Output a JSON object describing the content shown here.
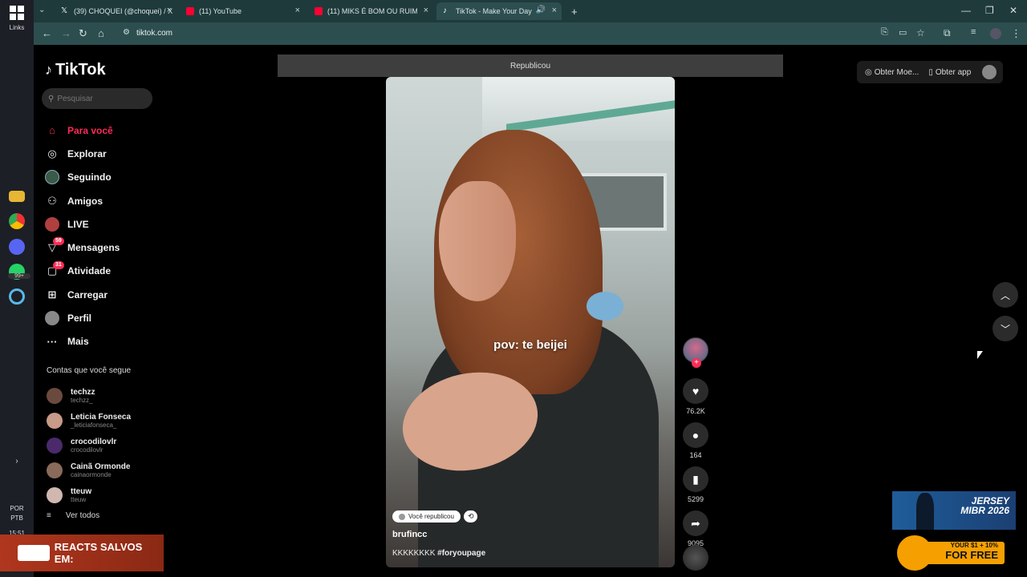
{
  "taskbar": {
    "links_label": "Links",
    "lang": "POR",
    "layout": "PTB",
    "time": "15:51",
    "date_fragment": "23",
    "whatsapp_badge": "99+"
  },
  "browser": {
    "tabs": [
      {
        "label": "(39) CHOQUEI (@choquei) / X",
        "icon": "x-icon",
        "color": "#222222"
      },
      {
        "label": "(11) YouTube",
        "icon": "youtube-icon",
        "color": "#ff0033"
      },
      {
        "label": "(11) MIKS É BOM OU RUIM? TE",
        "icon": "youtube-icon",
        "color": "#ff0033"
      },
      {
        "label": "TikTok - Make Your Day",
        "icon": "tiktok-icon",
        "color": "#111111"
      }
    ],
    "new_tab": "+",
    "url": "tiktok.com",
    "controls": {
      "minimize": "—",
      "restore": "❐",
      "close": "✕"
    }
  },
  "sidebar": {
    "logo_text": "TikTok",
    "search_placeholder": "Pesquisar",
    "nav": [
      {
        "label": "Para você",
        "icon": "home-icon",
        "active": true
      },
      {
        "label": "Explorar",
        "icon": "compass-icon"
      },
      {
        "label": "Seguindo",
        "icon": "following-icon"
      },
      {
        "label": "Amigos",
        "icon": "friends-icon"
      },
      {
        "label": "LIVE",
        "icon": "live-icon"
      },
      {
        "label": "Mensagens",
        "icon": "messages-icon",
        "badge": "59"
      },
      {
        "label": "Atividade",
        "icon": "activity-icon",
        "badge": "31"
      },
      {
        "label": "Carregar",
        "icon": "upload-icon"
      },
      {
        "label": "Perfil",
        "icon": "profile-icon"
      },
      {
        "label": "Mais",
        "icon": "more-icon"
      }
    ],
    "following_title": "Contas que você segue",
    "following": [
      {
        "name": "techzz",
        "handle": "techzz_",
        "color": "#6b4a3e"
      },
      {
        "name": "Leticia Fonseca",
        "handle": "_leticiafonseca_",
        "color": "#c89a88"
      },
      {
        "name": "crocodilovlr",
        "handle": "crocodilovlr",
        "color": "#4a2a6a"
      },
      {
        "name": "Cainã Ormonde",
        "handle": "cainaormonde",
        "color": "#8a6a5a"
      },
      {
        "name": "tteuw",
        "handle": "tteuw",
        "color": "#d0b8b0"
      }
    ],
    "see_all": "Ver todos"
  },
  "video": {
    "repost_header": "Republicou",
    "caption_overlay": "pov: te beijei",
    "repost_pill": "Você republicou",
    "author": "brufincc",
    "description": "KKKKKKKK",
    "hashtag": "#foryoupage"
  },
  "actions": {
    "likes": "76.2K",
    "comments": "164",
    "saves": "5299",
    "shares": "9095"
  },
  "topbar": {
    "get_coins": "Obter Moe...",
    "get_app": "Obter app"
  },
  "overlays": {
    "reacts_banner": "REACTS SALVOS EM:",
    "ad_title": "JERSEY MIBR 2026",
    "promo_line1": "YOUR $1 + 10%",
    "promo_line2": "FOR FREE"
  }
}
